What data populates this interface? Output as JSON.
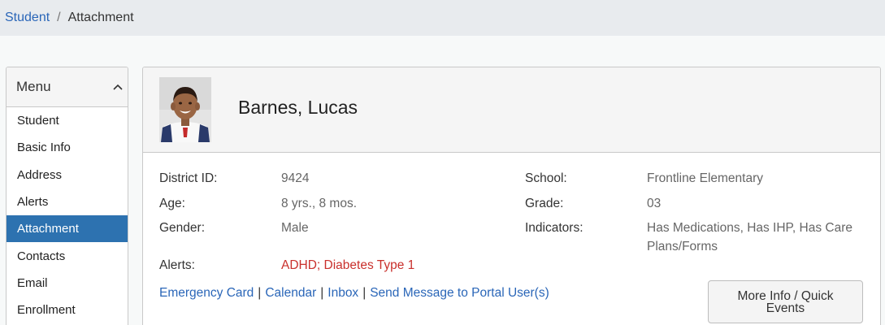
{
  "breadcrumb": {
    "parent": "Student",
    "separator": "/",
    "current": "Attachment"
  },
  "menu": {
    "title": "Menu",
    "toggle_icon": "chevron-up-icon",
    "items": [
      {
        "label": "Student",
        "active": false
      },
      {
        "label": "Basic Info",
        "active": false
      },
      {
        "label": "Address",
        "active": false
      },
      {
        "label": "Alerts",
        "active": false
      },
      {
        "label": "Attachment",
        "active": true
      },
      {
        "label": "Contacts",
        "active": false
      },
      {
        "label": "Email",
        "active": false
      },
      {
        "label": "Enrollment",
        "active": false
      }
    ]
  },
  "student": {
    "name": "Barnes, Lucas",
    "photo_icon": "student-photo",
    "fields": {
      "district_id": {
        "label": "District ID:",
        "value": "9424"
      },
      "age": {
        "label": "Age:",
        "value": "8 yrs., 8 mos."
      },
      "gender": {
        "label": "Gender:",
        "value": "Male"
      },
      "alerts": {
        "label": "Alerts:",
        "value": "ADHD; Diabetes Type 1"
      },
      "school": {
        "label": "School:",
        "value": "Frontline Elementary"
      },
      "grade": {
        "label": "Grade:",
        "value": "03"
      },
      "indicators": {
        "label": "Indicators:",
        "value_line1": "Has Medications, Has IHP, Has Care",
        "value_line2": "Plans/Forms"
      }
    }
  },
  "links": {
    "emergency_card": "Emergency Card",
    "calendar": "Calendar",
    "inbox": "Inbox",
    "send_message": "Send Message to Portal User(s)",
    "separator": "|"
  },
  "more_info_button": {
    "line1": "More Info / Quick",
    "line2": "Events"
  },
  "colors": {
    "link": "#2a66b8",
    "active_menu": "#2d72b0",
    "alert_text": "#c9302c"
  }
}
